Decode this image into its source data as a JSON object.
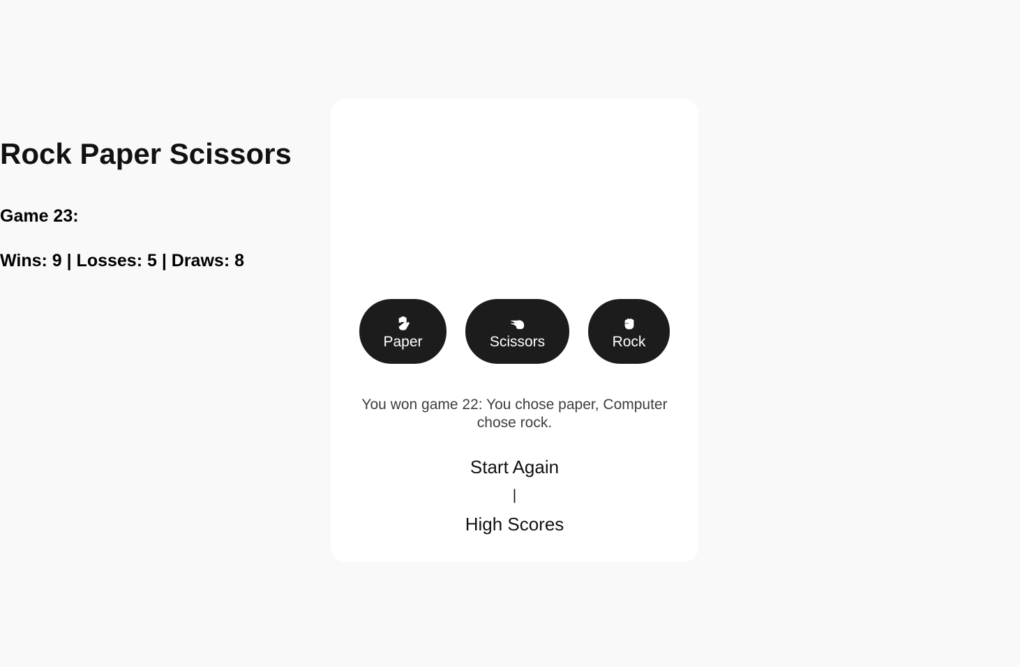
{
  "app": {
    "title": "Rock Paper Scissors"
  },
  "status": {
    "game_label": "Game 23:",
    "score_line": "Wins: 9 | Losses: 5 | Draws: 8"
  },
  "choices": [
    {
      "label": "Paper",
      "icon": "raised-hand-icon"
    },
    {
      "label": "Scissors",
      "icon": "scissors-hand-icon"
    },
    {
      "label": "Rock",
      "icon": "fist-icon"
    }
  ],
  "result": {
    "message": "You won game 22: You chose paper, Computer chose rock."
  },
  "links": {
    "start_again": "Start Again",
    "separator": "|",
    "high_scores": "High Scores"
  },
  "colors": {
    "page_background": "#f9f9f9",
    "card_background": "#ffffff",
    "button_background": "#1c1c1c",
    "button_text": "#ffffff",
    "result_text": "#3d3d3d"
  }
}
